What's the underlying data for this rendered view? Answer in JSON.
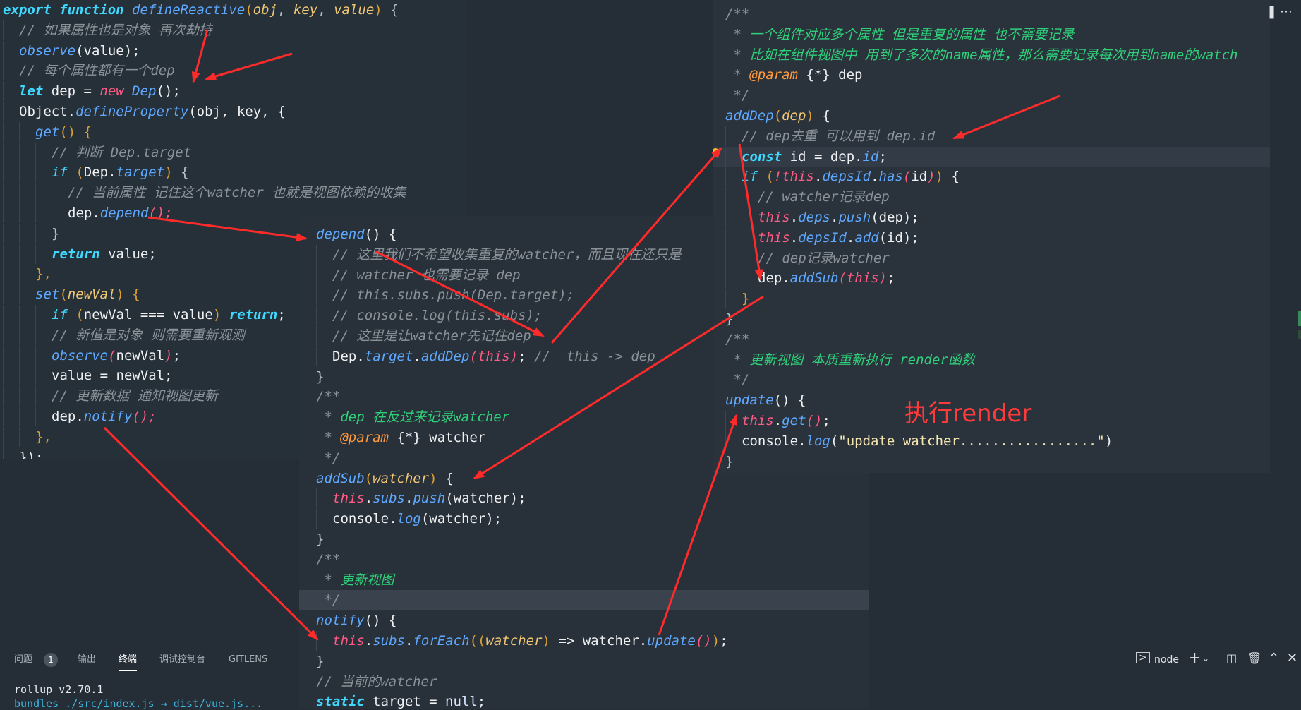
{
  "panes": [
    {
      "id": "define-reactive",
      "lines": [
        {
          "i": 0,
          "t": [
            [
              "kb",
              "export "
            ],
            [
              "kb",
              "function "
            ],
            [
              "f",
              "defineReactive"
            ],
            [
              "br",
              "("
            ],
            [
              "p",
              "obj"
            ],
            [
              "op",
              ", "
            ],
            [
              "p",
              "key"
            ],
            [
              "op",
              ", "
            ],
            [
              "p",
              "value"
            ],
            [
              "br",
              ")"
            ],
            [
              "op",
              " {"
            ]
          ]
        },
        {
          "i": 1,
          "t": [
            [
              "c",
              "// 如果属性也是对象 再次劫持"
            ]
          ]
        },
        {
          "i": 1,
          "t": [
            [
              "f",
              "observe"
            ],
            [
              "v",
              "(value);"
            ]
          ]
        },
        {
          "i": 1,
          "t": [
            [
              "c",
              "// 每个属性都有一个dep"
            ]
          ]
        },
        {
          "i": 1,
          "t": [
            [
              "kb",
              "let "
            ],
            [
              "v",
              "dep = "
            ],
            [
              "t",
              "new "
            ],
            [
              "f",
              "Dep"
            ],
            [
              "v",
              "();"
            ]
          ]
        },
        {
          "i": 1,
          "t": [
            [
              "v",
              "Object."
            ],
            [
              "f",
              "defineProperty"
            ],
            [
              "v",
              "(obj, key, {"
            ]
          ]
        },
        {
          "i": 2,
          "t": [
            [
              "f",
              "get"
            ],
            [
              "br",
              "() {"
            ]
          ]
        },
        {
          "i": 3,
          "t": [
            [
              "c",
              "// 判断 Dep.target"
            ]
          ]
        },
        {
          "i": 3,
          "t": [
            [
              "k",
              "if "
            ],
            [
              "br",
              "("
            ],
            [
              "v",
              "Dep."
            ],
            [
              "f",
              "target"
            ],
            [
              "br",
              ")"
            ],
            [
              "op",
              " {"
            ]
          ]
        },
        {
          "i": 4,
          "t": [
            [
              "c",
              "// 当前属性 记住这个watcher 也就是视图依赖的收集"
            ]
          ]
        },
        {
          "i": 4,
          "t": [
            [
              "v",
              "dep."
            ],
            [
              "f",
              "depend"
            ],
            [
              "t",
              "();"
            ]
          ]
        },
        {
          "i": 3,
          "t": [
            [
              "op",
              "}"
            ]
          ]
        },
        {
          "i": 3,
          "t": [
            [
              "kb",
              "return "
            ],
            [
              "v",
              "value;"
            ]
          ]
        },
        {
          "i": 2,
          "t": [
            [
              "br",
              "},"
            ]
          ]
        },
        {
          "i": 2,
          "t": [
            [
              "f",
              "set"
            ],
            [
              "br",
              "("
            ],
            [
              "p",
              "newVal"
            ],
            [
              "br",
              ") {"
            ]
          ]
        },
        {
          "i": 3,
          "t": [
            [
              "k",
              "if "
            ],
            [
              "br",
              "("
            ],
            [
              "v",
              "newVal === value"
            ],
            [
              "br",
              ") "
            ],
            [
              "kb",
              "return"
            ],
            [
              "v",
              ";"
            ]
          ]
        },
        {
          "i": 3,
          "t": [
            [
              "c",
              "// 新值是对象 则需要重新观测"
            ]
          ]
        },
        {
          "i": 3,
          "t": [
            [
              "f",
              "observe"
            ],
            [
              "t",
              "("
            ],
            [
              "v",
              "newVal"
            ],
            [
              "t",
              ")"
            ],
            [
              "v",
              ";"
            ]
          ]
        },
        {
          "i": 3,
          "t": [
            [
              "v",
              "value = newVal;"
            ]
          ]
        },
        {
          "i": 3,
          "t": [
            [
              "c",
              "// 更新数据 通知视图更新"
            ]
          ]
        },
        {
          "i": 3,
          "t": [
            [
              "v",
              "dep."
            ],
            [
              "f",
              "notify"
            ],
            [
              "t",
              "();"
            ]
          ]
        },
        {
          "i": 2,
          "t": [
            [
              "br",
              "},"
            ]
          ]
        },
        {
          "i": 1,
          "t": [
            [
              "v",
              "});"
            ]
          ]
        }
      ]
    },
    {
      "id": "dep-class",
      "lines": [
        {
          "i": 0,
          "t": [
            [
              "f",
              "depend"
            ],
            [
              "v",
              "() {"
            ]
          ]
        },
        {
          "i": 1,
          "t": [
            [
              "c",
              "// 这里我们不希望收集重复的watcher，而且现在还只是"
            ]
          ]
        },
        {
          "i": 1,
          "t": [
            [
              "c",
              "// watcher 也需要记录 dep"
            ]
          ]
        },
        {
          "i": 1,
          "t": [
            [
              "c",
              "// this.subs.push(Dep.target);"
            ]
          ]
        },
        {
          "i": 1,
          "t": [
            [
              "c",
              "// console.log(this.subs);"
            ]
          ]
        },
        {
          "i": 1,
          "t": [
            [
              "c",
              "// 这里是让watcher先记住dep"
            ]
          ]
        },
        {
          "i": 1,
          "t": [
            [
              "v",
              "Dep."
            ],
            [
              "f",
              "target"
            ],
            [
              "v",
              "."
            ],
            [
              "f",
              "addDep"
            ],
            [
              "t",
              "("
            ],
            [
              "t",
              "this"
            ],
            [
              "t",
              ")"
            ],
            [
              "v",
              "; "
            ],
            [
              "c",
              "//  this -> dep"
            ]
          ]
        },
        {
          "i": 0,
          "t": [
            [
              "op",
              "}"
            ]
          ]
        },
        {
          "i": 0,
          "t": [
            [
              "c",
              "/**"
            ]
          ]
        },
        {
          "i": 0,
          "t": [
            [
              "c",
              " * "
            ],
            [
              "cg",
              "dep 在反过来记录watcher"
            ]
          ]
        },
        {
          "i": 0,
          "t": [
            [
              "c",
              " * "
            ],
            [
              "tg",
              "@param "
            ],
            [
              "v",
              "{*} "
            ],
            [
              "v",
              "watcher"
            ]
          ]
        },
        {
          "i": 0,
          "t": [
            [
              "c",
              " */"
            ]
          ]
        },
        {
          "i": 0,
          "t": [
            [
              "f",
              "addSub"
            ],
            [
              "br",
              "("
            ],
            [
              "p",
              "watcher"
            ],
            [
              "br",
              ")"
            ],
            [
              "v",
              " {"
            ]
          ]
        },
        {
          "i": 1,
          "t": [
            [
              "t",
              "this"
            ],
            [
              "v",
              "."
            ],
            [
              "f",
              "subs"
            ],
            [
              "v",
              "."
            ],
            [
              "f",
              "push"
            ],
            [
              "v",
              "(watcher);"
            ]
          ]
        },
        {
          "i": 1,
          "t": [
            [
              "v",
              "console."
            ],
            [
              "f",
              "log"
            ],
            [
              "v",
              "(watcher);"
            ]
          ]
        },
        {
          "i": 0,
          "t": [
            [
              "op",
              "}"
            ]
          ]
        },
        {
          "i": 0,
          "t": [
            [
              "c",
              "/**"
            ]
          ]
        },
        {
          "i": 0,
          "t": [
            [
              "c",
              " * "
            ],
            [
              "cg",
              "更新视图"
            ]
          ]
        },
        {
          "i": 0,
          "hl": true,
          "t": [
            [
              "c",
              " */"
            ]
          ]
        },
        {
          "i": 0,
          "t": [
            [
              "f",
              "notify"
            ],
            [
              "v",
              "() {"
            ]
          ]
        },
        {
          "i": 1,
          "t": [
            [
              "t",
              "this"
            ],
            [
              "v",
              "."
            ],
            [
              "f",
              "subs"
            ],
            [
              "v",
              "."
            ],
            [
              "f",
              "forEach"
            ],
            [
              "br",
              "(("
            ],
            [
              "p",
              "watcher"
            ],
            [
              "br",
              ")"
            ],
            [
              "v",
              " => watcher."
            ],
            [
              "f",
              "update"
            ],
            [
              "t",
              "()"
            ],
            [
              "br",
              ")"
            ],
            [
              "v",
              ";"
            ]
          ]
        },
        {
          "i": 0,
          "t": [
            [
              "op",
              "}"
            ]
          ]
        },
        {
          "i": 0,
          "t": [
            [
              "c",
              "// 当前的watcher"
            ]
          ]
        },
        {
          "i": 0,
          "t": [
            [
              "kb",
              "static "
            ],
            [
              "v",
              "target = "
            ],
            [
              "n",
              "null"
            ],
            [
              "v",
              ";"
            ]
          ]
        }
      ]
    },
    {
      "id": "watcher-class",
      "lines": [
        {
          "i": 0,
          "t": [
            [
              "c",
              "/**"
            ]
          ]
        },
        {
          "i": 0,
          "t": [
            [
              "c",
              " * "
            ],
            [
              "cg",
              "一个组件对应多个属性 但是重复的属性 也不需要记录"
            ]
          ]
        },
        {
          "i": 0,
          "t": [
            [
              "c",
              " * "
            ],
            [
              "cg",
              "比如在组件视图中 用到了多次的name属性，那么需要记录每次用到name的watch"
            ]
          ]
        },
        {
          "i": 0,
          "t": [
            [
              "c",
              " * "
            ],
            [
              "tg",
              "@param "
            ],
            [
              "v",
              "{*} "
            ],
            [
              "v",
              "dep"
            ]
          ]
        },
        {
          "i": 0,
          "t": [
            [
              "c",
              " */"
            ]
          ]
        },
        {
          "i": 0,
          "t": [
            [
              "f",
              "addDep"
            ],
            [
              "br",
              "("
            ],
            [
              "p",
              "dep"
            ],
            [
              "br",
              ")"
            ],
            [
              "v",
              " {"
            ]
          ]
        },
        {
          "i": 1,
          "t": [
            [
              "c",
              "// dep去重 可以用到 dep.id"
            ]
          ]
        },
        {
          "i": 1,
          "cur": true,
          "t": [
            [
              "kb",
              "const "
            ],
            [
              "v",
              "id = dep."
            ],
            [
              "f",
              "id"
            ],
            [
              "v",
              ";"
            ]
          ]
        },
        {
          "i": 1,
          "t": [
            [
              "k",
              "if "
            ],
            [
              "br",
              "("
            ],
            [
              "t",
              "!"
            ],
            [
              "t",
              "this"
            ],
            [
              "v",
              "."
            ],
            [
              "f",
              "depsId"
            ],
            [
              "v",
              "."
            ],
            [
              "f",
              "has"
            ],
            [
              "t",
              "("
            ],
            [
              "v",
              "id"
            ],
            [
              "t",
              ")"
            ],
            [
              "br",
              ")"
            ],
            [
              "v",
              " {"
            ]
          ]
        },
        {
          "i": 2,
          "t": [
            [
              "c",
              "// watcher记录dep"
            ]
          ]
        },
        {
          "i": 2,
          "t": [
            [
              "t",
              "this"
            ],
            [
              "v",
              "."
            ],
            [
              "f",
              "deps"
            ],
            [
              "v",
              "."
            ],
            [
              "f",
              "push"
            ],
            [
              "v",
              "(dep);"
            ]
          ]
        },
        {
          "i": 2,
          "t": [
            [
              "t",
              "this"
            ],
            [
              "v",
              "."
            ],
            [
              "f",
              "depsId"
            ],
            [
              "v",
              "."
            ],
            [
              "f",
              "add"
            ],
            [
              "v",
              "(id);"
            ]
          ]
        },
        {
          "i": 2,
          "t": [
            [
              "c",
              "// dep记录watcher"
            ]
          ]
        },
        {
          "i": 2,
          "t": [
            [
              "v",
              "dep."
            ],
            [
              "f",
              "addSub"
            ],
            [
              "t",
              "("
            ],
            [
              "t",
              "this"
            ],
            [
              "t",
              ")"
            ],
            [
              "v",
              ";"
            ]
          ]
        },
        {
          "i": 1,
          "t": [
            [
              "br",
              "}"
            ]
          ]
        },
        {
          "i": 0,
          "t": [
            [
              "op",
              "}"
            ]
          ]
        },
        {
          "i": 0,
          "t": [
            [
              "c",
              "/**"
            ]
          ]
        },
        {
          "i": 0,
          "t": [
            [
              "c",
              " * "
            ],
            [
              "cg",
              "更新视图 本质重新执行 render函数"
            ]
          ]
        },
        {
          "i": 0,
          "t": [
            [
              "c",
              " */"
            ]
          ]
        },
        {
          "i": 0,
          "t": [
            [
              "f",
              "update"
            ],
            [
              "v",
              "() {"
            ]
          ]
        },
        {
          "i": 1,
          "t": [
            [
              "t",
              "this"
            ],
            [
              "v",
              "."
            ],
            [
              "f",
              "get"
            ],
            [
              "t",
              "()"
            ],
            [
              "v",
              ";"
            ]
          ]
        },
        {
          "i": 1,
          "t": [
            [
              "v",
              "console."
            ],
            [
              "f",
              "log"
            ],
            [
              "v",
              "("
            ],
            [
              "s",
              "\"update watcher.................\""
            ],
            [
              "v",
              ")"
            ]
          ]
        },
        {
          "i": 0,
          "t": [
            [
              "op",
              "}"
            ]
          ]
        }
      ]
    }
  ],
  "annotation": "执行render",
  "panel": {
    "tabs": [
      "问题",
      "输出",
      "终端",
      "调试控制台",
      "GITLENS"
    ],
    "problems_count": "1",
    "active_tab": "终端",
    "terminal_lines": [
      "rollup v2.70.1",
      "bundles ./src/index.js → dist/vue.js..."
    ],
    "terminal_name": "node"
  },
  "colors": {
    "arrow": "#ff2b2b",
    "editor_bg": "#263039",
    "accent": "#3fd8ff"
  }
}
